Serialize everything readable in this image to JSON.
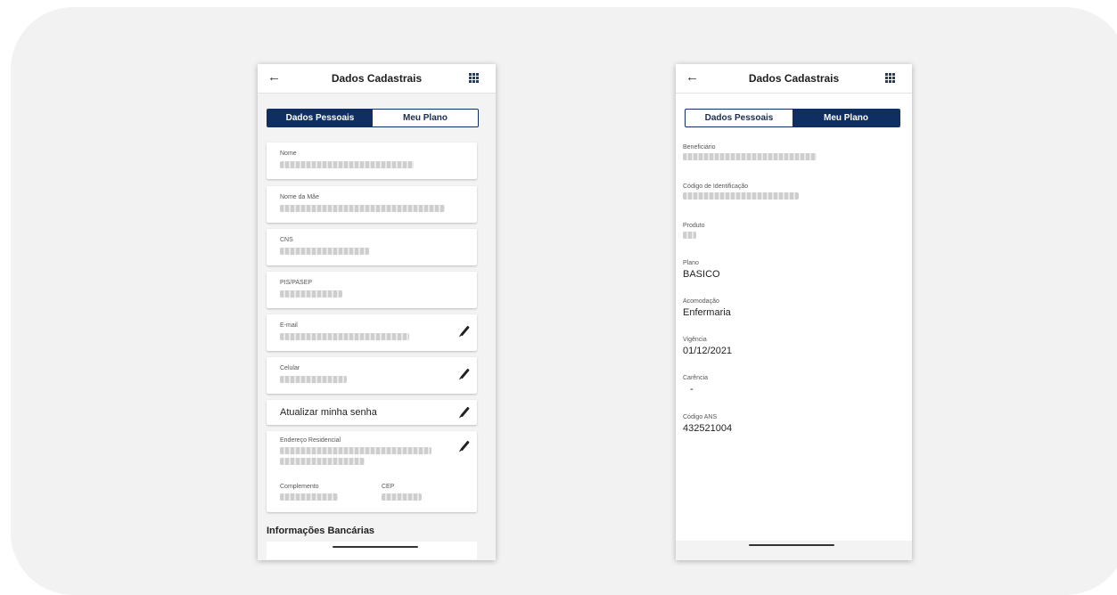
{
  "left_screen": {
    "header": {
      "title": "Dados Cadastrais",
      "back_icon": "arrow-left-icon",
      "menu_icon": "grid-icon"
    },
    "tabs": [
      {
        "label": "Dados Pessoais",
        "active": true
      },
      {
        "label": "Meu Plano",
        "active": false
      }
    ],
    "fields": {
      "nome": "Nome",
      "nome_mae": "Nome da Mãe",
      "cns": "CNS",
      "pis": "PIS/PASEP",
      "email": "E-mail",
      "celular": "Celular",
      "senha": "Atualizar minha senha",
      "endereco": "Endereço Residencial",
      "complemento": "Complemento",
      "cep": "CEP"
    },
    "section_bank": "Informações Bancárias"
  },
  "right_screen": {
    "header": {
      "title": "Dados Cadastrais",
      "back_icon": "arrow-left-icon",
      "menu_icon": "grid-icon"
    },
    "tabs": [
      {
        "label": "Dados Pessoais",
        "active": false
      },
      {
        "label": "Meu Plano",
        "active": true
      }
    ],
    "fields": {
      "beneficiario": "Beneficiário",
      "codigo_id": "Código de Identificação",
      "produto": "Produto",
      "plano": {
        "label": "Plano",
        "value": "BASICO"
      },
      "acomodacao": {
        "label": "Acomodação",
        "value": "Enfermaria"
      },
      "vigencia": {
        "label": "Vigência",
        "value": "01/12/2021"
      },
      "carencia": {
        "label": "Carência",
        "value": "-"
      },
      "codigo_ans": {
        "label": "Código ANS",
        "value": "432521004"
      }
    }
  },
  "colors": {
    "primary": "#0f2f62",
    "background": "#f2f2f2"
  }
}
